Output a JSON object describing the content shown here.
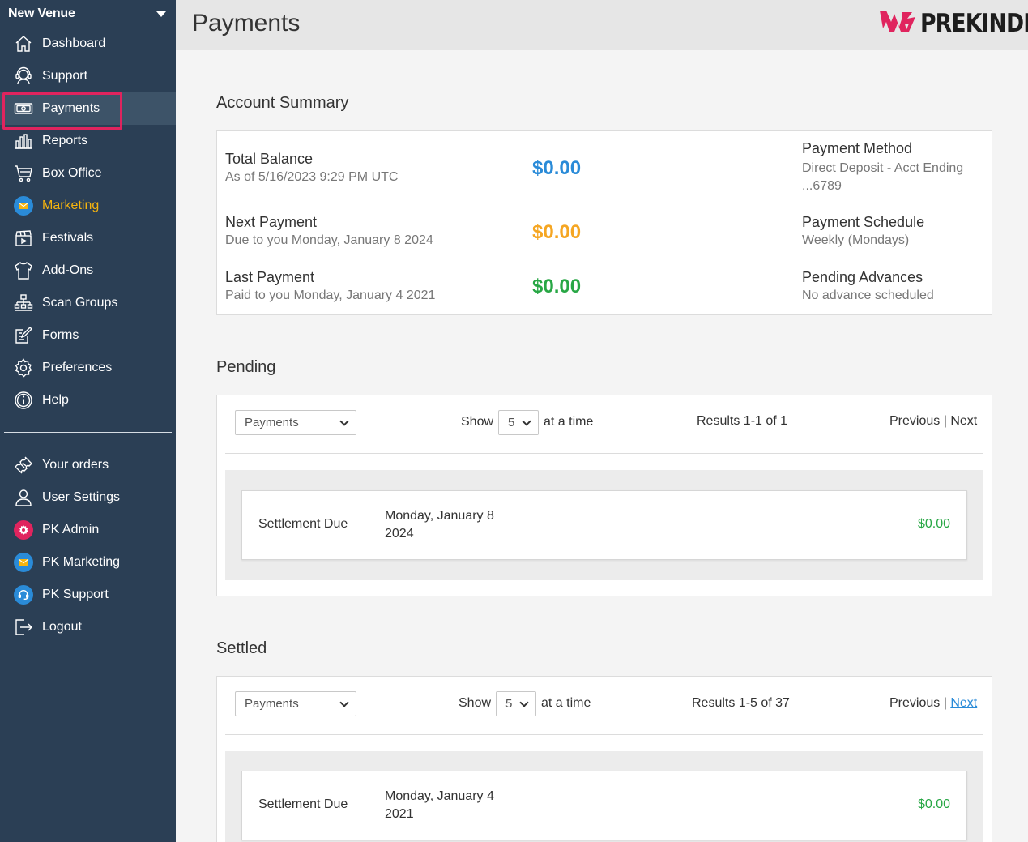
{
  "sidebar": {
    "venue": "New Venue",
    "items": [
      {
        "label": "Dashboard",
        "icon": "home-icon"
      },
      {
        "label": "Support",
        "icon": "headset-icon"
      },
      {
        "label": "Payments",
        "icon": "cash-icon"
      },
      {
        "label": "Reports",
        "icon": "bar-chart-icon"
      },
      {
        "label": "Box Office",
        "icon": "cart-icon"
      },
      {
        "label": "Marketing",
        "icon": "mail-icon"
      },
      {
        "label": "Festivals",
        "icon": "clapperboard-icon"
      },
      {
        "label": "Add-Ons",
        "icon": "tshirt-icon"
      },
      {
        "label": "Scan Groups",
        "icon": "org-chart-icon"
      },
      {
        "label": "Forms",
        "icon": "edit-form-icon"
      },
      {
        "label": "Preferences",
        "icon": "gear-icon"
      },
      {
        "label": "Help",
        "icon": "info-icon"
      }
    ],
    "bottom_items": [
      {
        "label": "Your orders",
        "icon": "ticket-icon"
      },
      {
        "label": "User Settings",
        "icon": "user-icon"
      },
      {
        "label": "PK Admin",
        "icon": "admin-gear-icon"
      },
      {
        "label": "PK Marketing",
        "icon": "mail-icon"
      },
      {
        "label": "PK Support",
        "icon": "headset-icon"
      },
      {
        "label": "Logout",
        "icon": "logout-icon"
      }
    ],
    "active": "Payments",
    "colors": {
      "bg": "#2b3f55",
      "active_bg": "#3d5368",
      "highlight_border": "#e0245e",
      "marketing": "#f6b40e"
    }
  },
  "header": {
    "title": "Payments",
    "logo_text": "PREKINDLE",
    "logo_color": "#e0245e"
  },
  "summary": {
    "title": "Account Summary",
    "total_balance": {
      "label": "Total Balance",
      "sub": "As of 5/16/2023 9:29 PM UTC",
      "amount": "$0.00",
      "color": "#2a8bd8"
    },
    "next_payment": {
      "label": "Next Payment",
      "sub": "Due to you Monday, January 8 2024",
      "amount": "$0.00",
      "color": "#f5a623"
    },
    "last_payment": {
      "label": "Last Payment",
      "sub": "Paid to you Monday, January 4 2021",
      "amount": "$0.00",
      "color": "#28a745"
    },
    "payment_method": {
      "label": "Payment Method",
      "sub": "Direct Deposit - Acct Ending ...6789"
    },
    "payment_schedule": {
      "label": "Payment Schedule",
      "sub": "Weekly (Mondays)"
    },
    "pending_advances": {
      "label": "Pending Advances",
      "sub": "No advance scheduled"
    }
  },
  "pending": {
    "title": "Pending",
    "filter": "Payments",
    "show_label": "Show",
    "show_value": "5",
    "at_a_time": "at a time",
    "results": "Results 1-1 of 1",
    "previous": "Previous",
    "separator": "|",
    "next": "Next",
    "rows": [
      {
        "type": "Settlement Due",
        "date": "Monday, January 8 2024",
        "amount": "$0.00"
      }
    ]
  },
  "settled": {
    "title": "Settled",
    "filter": "Payments",
    "show_label": "Show",
    "show_value": "5",
    "at_a_time": "at a time",
    "results": "Results 1-5 of 37",
    "previous": "Previous",
    "separator": "|",
    "next": "Next",
    "rows": [
      {
        "type": "Settlement Due",
        "date": "Monday, January 4 2021",
        "amount": "$0.00"
      }
    ]
  }
}
